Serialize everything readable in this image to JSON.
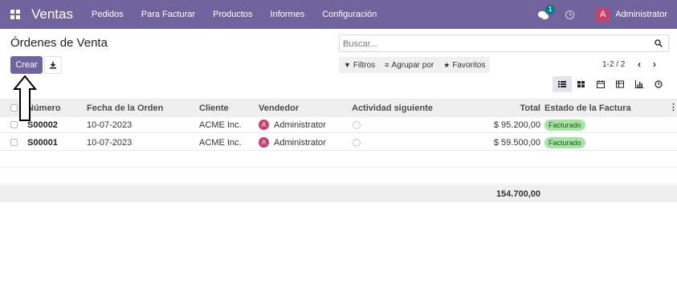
{
  "navbar": {
    "brand": "Ventas",
    "menu": [
      "Pedidos",
      "Para Facturar",
      "Productos",
      "Informes",
      "Configuración"
    ],
    "chat_badge": "1",
    "user_initial": "A",
    "user_name": "Administrator",
    "color": "#71639e"
  },
  "control_panel": {
    "title": "Órdenes de Venta",
    "search_placeholder": "Buscar...",
    "create_label": "Crear",
    "filters_label": "Filtros",
    "group_by_label": "Agrupar por",
    "favorites_label": "Favoritos",
    "pager": "1-2 / 2",
    "views": [
      "list-icon",
      "kanban-icon",
      "calendar-icon",
      "pivot-icon",
      "graph-icon",
      "activity-icon"
    ]
  },
  "list": {
    "headers": {
      "number": "Número",
      "date": "Fecha de la Orden",
      "customer": "Cliente",
      "salesperson": "Vendedor",
      "activity": "Actividad siguiente",
      "total": "Total",
      "invoice_status": "Estado de la Factura"
    },
    "rows": [
      {
        "number": "S00002",
        "date": "10-07-2023",
        "customer": "ACME Inc.",
        "salesperson_initial": "A",
        "salesperson": "Administrator",
        "total": "$ 95.200,00",
        "invoice_status": "Facturado"
      },
      {
        "number": "S00001",
        "date": "10-07-2023",
        "customer": "ACME Inc.",
        "salesperson_initial": "A",
        "salesperson": "Administrator",
        "total": "$ 59.500,00",
        "invoice_status": "Facturado"
      }
    ],
    "sum_total": "154.700,00"
  }
}
